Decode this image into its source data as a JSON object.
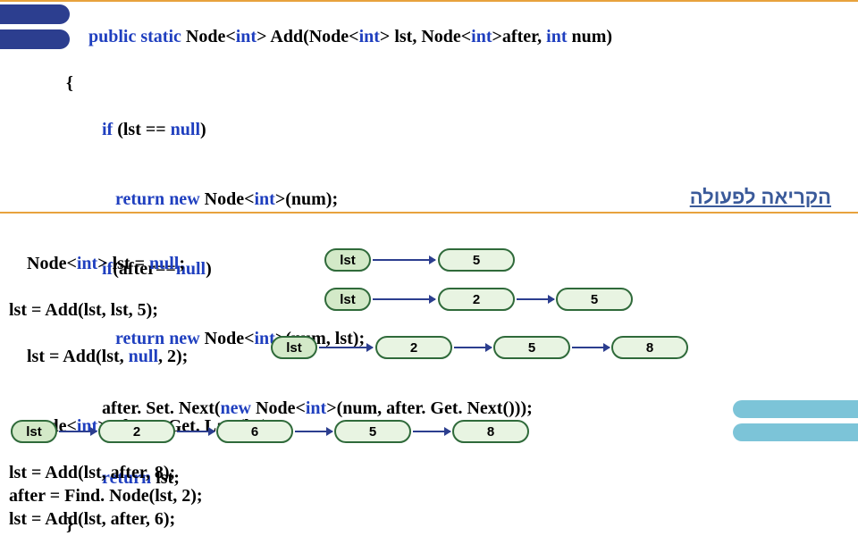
{
  "code": {
    "l1_pre": " ",
    "l1_kw1": "public",
    "l1_sp1": " ",
    "l1_kw2": "static",
    "l1_sp2": " Node<",
    "l1_kw3": "int",
    "l1_mid1": "> Add(Node<",
    "l1_kw4": "int",
    "l1_mid2": "> lst, Node<",
    "l1_kw5": "int",
    "l1_mid3": ">after, ",
    "l1_kw6": "int",
    "l1_end": " num)",
    "l2": "{",
    "l3_pre": "    ",
    "l3_kw1": "if",
    "l3_mid": " (lst == ",
    "l3_kw2": "null",
    "l3_end": ")",
    "l4_pre": "       ",
    "l4_kw1": "return",
    "l4_sp": " ",
    "l4_kw2": "new",
    "l4_mid": " Node<",
    "l4_kw3": "int",
    "l4_end": ">(num);",
    "l5_pre": "    ",
    "l5_kw1": "if",
    "l5_mid": "(after==",
    "l5_kw2": "null",
    "l5_end": ")",
    "l6_pre": "       ",
    "l6_kw1": "return",
    "l6_sp": " ",
    "l6_kw2": "new",
    "l6_mid": " Node<",
    "l6_kw3": "int",
    "l6_end": ">(num, lst);",
    "l7_pre": "    after. Set. Next(",
    "l7_kw1": "new",
    "l7_mid": " Node<",
    "l7_kw2": "int",
    "l7_end": ">(num, after. Get. Next()));",
    "l8_pre": "    ",
    "l8_kw1": "return",
    "l8_end": " lst;",
    "l9": "}"
  },
  "heb_label": "הקריאה לפעולה",
  "example": {
    "l1_a": "Node<",
    "l1_kw1": "int",
    "l1_b": "> lst = ",
    "l1_kw2": "null",
    "l1_c": ";",
    "l2": "lst = Add(lst, lst, 5);",
    "l3_a": "lst = Add(lst, ",
    "l3_kw": "null",
    "l3_b": ", 2);",
    "l4_a": "Node<",
    "l4_kw": "int",
    "l4_b": "> after = Get. Last(lst);",
    "l5": "lst = Add(lst, after, 8);",
    "l6": "after = Find. Node(lst, 2);",
    "l7": "lst = Add(lst, after, 6);"
  },
  "diagram": {
    "lst_label": "lst",
    "row1": {
      "v1": "5"
    },
    "row2": {
      "v1": "2",
      "v2": "5"
    },
    "row3": {
      "v1": "2",
      "v2": "5",
      "v3": "8"
    },
    "row4": {
      "v1": "2",
      "v2": "6",
      "v3": "5",
      "v4": "8"
    }
  }
}
